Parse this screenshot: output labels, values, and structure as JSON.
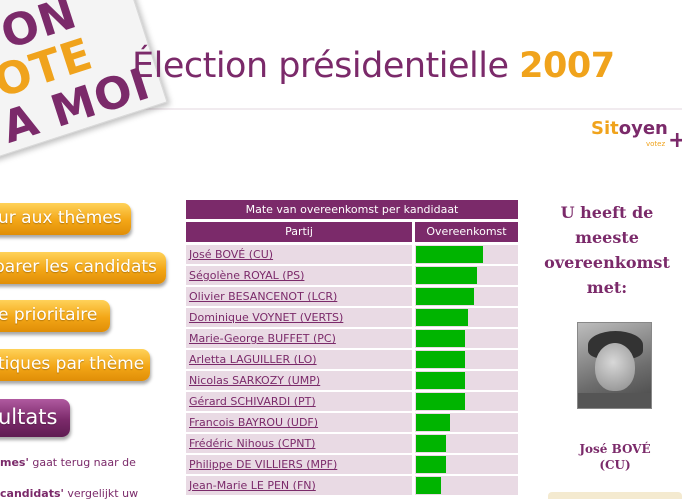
{
  "header": {
    "logo_lines": [
      "ON",
      "OTE",
      "A MOI"
    ],
    "title_main": "Élection présidentielle",
    "title_year": "2007",
    "brand_first": "Sit",
    "brand_second": "oyen",
    "brand_sub": "votez",
    "brand_plus": "+"
  },
  "menu": {
    "items": [
      {
        "label": "ur aux thèmes"
      },
      {
        "label": "parer les candidats"
      },
      {
        "label": "e prioritaire"
      },
      {
        "label": "tiques par thème"
      },
      {
        "label": "ultats"
      }
    ],
    "text1_bold": "mes'",
    "text1_rest": " gaat terug naar de",
    "text2_bold": "candidats'",
    "text2_rest": " vergelijkt uw"
  },
  "table": {
    "title": "Mate van overeenkomst per kandidaat",
    "col_party": "Partij",
    "col_match": "Overeenkomst"
  },
  "candidates": [
    {
      "name": "José BOVÉ (CU)",
      "match": 0.66
    },
    {
      "name": "Ségolène ROYAL (PS)",
      "match": 0.6
    },
    {
      "name": "Olivier BESANCENOT (LCR)",
      "match": 0.57
    },
    {
      "name": "Dominique VOYNET (VERTS)",
      "match": 0.51
    },
    {
      "name": "Marie-George BUFFET (PC)",
      "match": 0.49
    },
    {
      "name": "Arletta LAGUILLER (LO)",
      "match": 0.49
    },
    {
      "name": "Nicolas SARKOZY (UMP)",
      "match": 0.49
    },
    {
      "name": "Gérard SCHIVARDI (PT)",
      "match": 0.49
    },
    {
      "name": "Francois BAYROU (UDF)",
      "match": 0.34
    },
    {
      "name": "Frédéric Nihous (CPNT)",
      "match": 0.3
    },
    {
      "name": "Philippe DE VILLIERS (MPF)",
      "match": 0.3
    },
    {
      "name": "Jean-Marie LE PEN (FN)",
      "match": 0.25
    }
  ],
  "result": {
    "heading": "U heeft de meeste overeenkomst met:",
    "candidate_name": "José BOVÉ",
    "candidate_party": "(CU)"
  },
  "colors": {
    "purple": "#7b2a6a",
    "orange": "#f0a31c",
    "bar_green": "#00b400",
    "row_bg": "#e9dae4"
  }
}
